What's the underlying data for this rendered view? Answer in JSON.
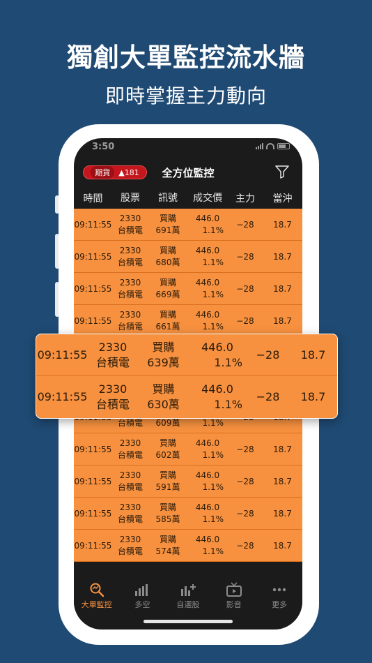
{
  "headline": "獨創大單監控流水牆",
  "subline": "即時掌握主力動向",
  "status_bar": {
    "time": "3:50"
  },
  "header": {
    "badge_label": "期貨",
    "badge_value": "▲181",
    "title": "全方位監控",
    "filter_icon": "filter-icon"
  },
  "columns": [
    "時間",
    "股票",
    "訊號",
    "成交價",
    "主力",
    "當沖"
  ],
  "rows": [
    {
      "time": "09:11:55",
      "code": "2330",
      "name": "台積電",
      "signal": "買購",
      "amount": "691萬",
      "price": "446.0",
      "change": "1.1%",
      "main": "−28",
      "daytrade": "18.7"
    },
    {
      "time": "09:11:55",
      "code": "2330",
      "name": "台積電",
      "signal": "買購",
      "amount": "680萬",
      "price": "446.0",
      "change": "1.1%",
      "main": "−28",
      "daytrade": "18.7"
    },
    {
      "time": "09:11:55",
      "code": "2330",
      "name": "台積電",
      "signal": "買購",
      "amount": "669萬",
      "price": "446.0",
      "change": "1.1%",
      "main": "−28",
      "daytrade": "18.7"
    },
    {
      "time": "09:11:55",
      "code": "2330",
      "name": "台積電",
      "signal": "買購",
      "amount": "661萬",
      "price": "446.0",
      "change": "1.1%",
      "main": "−28",
      "daytrade": "18.7"
    },
    {
      "time": "09:11:55",
      "code": "2330",
      "name": "台積電",
      "signal": "買購",
      "amount": "639萬",
      "price": "446.0",
      "change": "1.1%",
      "main": "−28",
      "daytrade": "18.7"
    },
    {
      "time": "09:11:55",
      "code": "2330",
      "name": "台積電",
      "signal": "買購",
      "amount": "630萬",
      "price": "446.0",
      "change": "1.1%",
      "main": "−28",
      "daytrade": "18.7"
    },
    {
      "time": "09:11:55",
      "code": "2330",
      "name": "台積電",
      "signal": "買購",
      "amount": "609萬",
      "price": "446.0",
      "change": "1.1%",
      "main": "−28",
      "daytrade": "18.7"
    },
    {
      "time": "09:11:55",
      "code": "2330",
      "name": "台積電",
      "signal": "買購",
      "amount": "602萬",
      "price": "446.0",
      "change": "1.1%",
      "main": "−28",
      "daytrade": "18.7"
    },
    {
      "time": "09:11:55",
      "code": "2330",
      "name": "台積電",
      "signal": "買購",
      "amount": "591萬",
      "price": "446.0",
      "change": "1.1%",
      "main": "−28",
      "daytrade": "18.7"
    },
    {
      "time": "09:11:55",
      "code": "2330",
      "name": "台積電",
      "signal": "買購",
      "amount": "585萬",
      "price": "446.0",
      "change": "1.1%",
      "main": "−28",
      "daytrade": "18.7"
    },
    {
      "time": "09:11:55",
      "code": "2330",
      "name": "台積電",
      "signal": "買購",
      "amount": "574萬",
      "price": "446.0",
      "change": "1.1%",
      "main": "−28",
      "daytrade": "18.7"
    }
  ],
  "highlight_rows": [
    {
      "time": "09:11:55",
      "code": "2330",
      "name": "台積電",
      "signal": "買購",
      "amount": "639萬",
      "price": "446.0",
      "change": "1.1%",
      "main": "−28",
      "daytrade": "18.7"
    },
    {
      "time": "09:11:55",
      "code": "2330",
      "name": "台積電",
      "signal": "買購",
      "amount": "630萬",
      "price": "446.0",
      "change": "1.1%",
      "main": "−28",
      "daytrade": "18.7"
    }
  ],
  "tabs": [
    {
      "label": "大單監控",
      "icon": "magnifier-icon",
      "active": true
    },
    {
      "label": "多空",
      "icon": "bar-chart-icon",
      "active": false
    },
    {
      "label": "自選股",
      "icon": "chart-plus-icon",
      "active": false
    },
    {
      "label": "影音",
      "icon": "tv-icon",
      "active": false
    },
    {
      "label": "更多",
      "icon": "more-dots-icon",
      "active": false
    }
  ],
  "colors": {
    "background": "#1f4a73",
    "row": "#f7913f",
    "badge": "#c4171d",
    "screen": "#1b1b1b"
  }
}
